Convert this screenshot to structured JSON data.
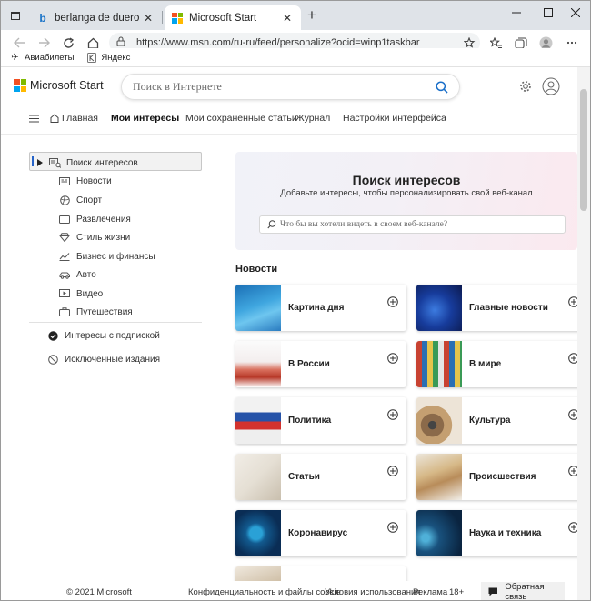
{
  "browser": {
    "tabs": [
      {
        "title": "berlanga de duero - Bing images",
        "active": false
      },
      {
        "title": "Microsoft Start",
        "active": true
      }
    ],
    "address": "https://www.msn.com/ru-ru/feed/personalize?ocid=winp1taskbar",
    "favorites": [
      "Авиабилеты",
      "Яндекс"
    ]
  },
  "header": {
    "brand": "Microsoft Start",
    "search_placeholder": "Поиск в Интернете"
  },
  "nav": {
    "home": "Главная",
    "interests": "Мои интересы",
    "saved": "Мои сохраненные статьи",
    "journal": "Журнал",
    "settings": "Настройки интерфейса"
  },
  "sidebar": {
    "search_interests": "Поиск интересов",
    "categories": [
      "Новости",
      "Спорт",
      "Развлечения",
      "Стиль жизни",
      "Бизнес и финансы",
      "Авто",
      "Видео",
      "Путешествия"
    ],
    "subscribed": "Интересы с подпиской",
    "excluded": "Исключённые издания"
  },
  "hero": {
    "title": "Поиск интересов",
    "subtitle": "Добавьте интересы, чтобы персонализировать свой веб-канал",
    "placeholder": "Что бы вы хотели видеть в своем веб-канале?"
  },
  "section": {
    "title": "Новости",
    "cards": [
      {
        "label": "Картина дня"
      },
      {
        "label": "Главные новости"
      },
      {
        "label": "В России"
      },
      {
        "label": "В мире"
      },
      {
        "label": "Политика"
      },
      {
        "label": "Культура"
      },
      {
        "label": "Статьи"
      },
      {
        "label": "Происшествия"
      },
      {
        "label": "Коронавирус"
      },
      {
        "label": "Наука и техника"
      }
    ]
  },
  "footer": {
    "copyright": "© 2021 Microsoft",
    "privacy": "Конфиденциальность и файлы cookie",
    "terms": "Условия использования",
    "ads": "Реклама",
    "age": "18+",
    "feedback": "Обратная связь"
  },
  "colors": {
    "accent": "#2563c9",
    "brand_red": "#f25022",
    "brand_green": "#7fba00",
    "brand_blue": "#00a4ef",
    "brand_yellow": "#ffb900"
  }
}
